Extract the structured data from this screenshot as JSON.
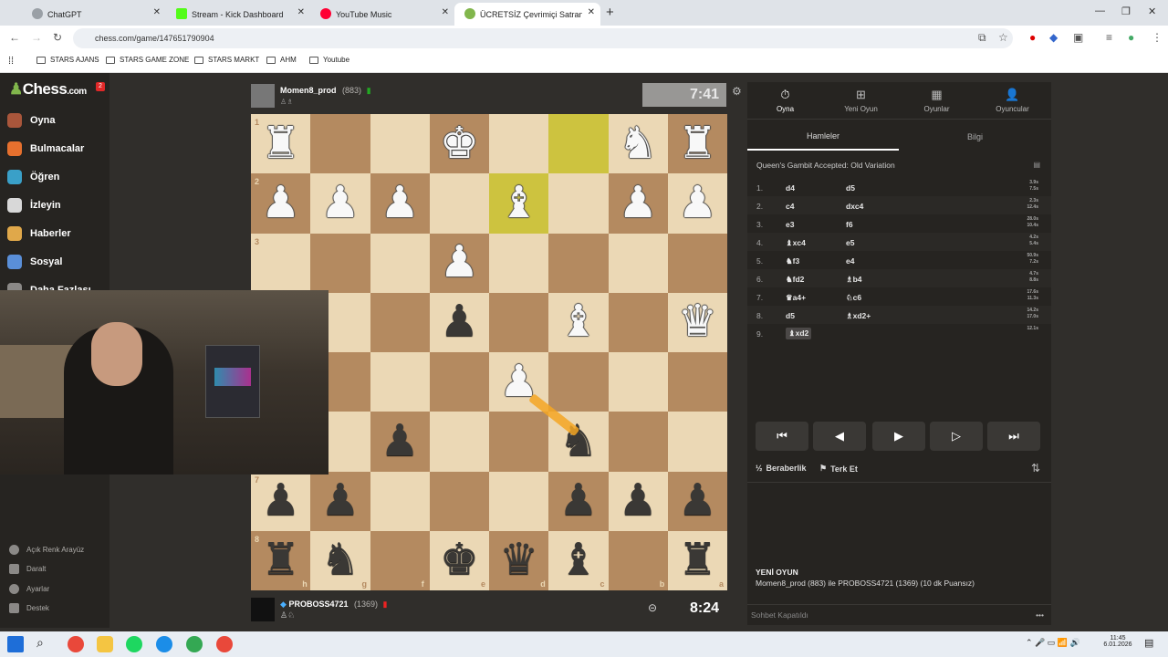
{
  "browser": {
    "tabs": [
      {
        "title": "ChatGPT",
        "color": "#9aa0a6"
      },
      {
        "title": "Stream - Kick Dashboard",
        "color": "#53fc18"
      },
      {
        "title": "YouTube Music",
        "color": "#ff0033"
      },
      {
        "title": "ÜCRETSİZ Çevrimiçi Satranç Oy",
        "color": "#81b64c"
      }
    ],
    "url": "chess.com/game/147651790904",
    "bookmarks": [
      "STARS AJANS",
      "STARS GAME ZONE",
      "STARS MARKT",
      "AHM",
      "Youtube"
    ]
  },
  "sidebar": {
    "logo": "Chess",
    "logo_suffix": ".com",
    "badge": "2",
    "nav": [
      "Oyna",
      "Bulmacalar",
      "Öğren",
      "İzleyin",
      "Haberler",
      "Sosyal",
      "Daha Fazlası"
    ],
    "footer": [
      "Açık Renk Arayüz",
      "Daralt",
      "Ayarlar",
      "Destek"
    ]
  },
  "top_player": {
    "name": "Momen8_prod",
    "rating": "(883)",
    "clock": "7:41"
  },
  "bottom_player": {
    "name": "PROBOSS4721",
    "rating": "(1369)",
    "clock": "8:24"
  },
  "board": {
    "ranks": [
      "1",
      "2",
      "3",
      "4",
      "5",
      "6",
      "7",
      "8"
    ],
    "files": [
      "h",
      "g",
      "f",
      "e",
      "d",
      "c",
      "b",
      "a"
    ],
    "light": "#ebd8b5",
    "dark": "#b48a60",
    "highlight": "#cdc33f"
  },
  "panel": {
    "tabs": [
      "Oyna",
      "Yeni Oyun",
      "Oyunlar",
      "Oyuncular"
    ],
    "subtabs": [
      "Hamleler",
      "Bilgi"
    ],
    "opening": "Queen's Gambit Accepted: Old Variation",
    "moves": [
      {
        "n": "1.",
        "w": "d4",
        "b": "d5",
        "tw": "3.9s",
        "tb": "7.5s"
      },
      {
        "n": "2.",
        "w": "c4",
        "b": "dxc4",
        "tw": "2.3s",
        "tb": "12.4s"
      },
      {
        "n": "3.",
        "w": "e3",
        "b": "f6",
        "tw": "28.0s",
        "tb": "10.4s"
      },
      {
        "n": "4.",
        "w": "♝xc4",
        "b": "e5",
        "tw": "4.2s",
        "tb": "5.4s"
      },
      {
        "n": "5.",
        "w": "♞f3",
        "b": "e4",
        "tw": "50.9s",
        "tb": "7.2s"
      },
      {
        "n": "6.",
        "w": "♞fd2",
        "b": "♗b4",
        "tw": "4.7s",
        "tb": "8.8s"
      },
      {
        "n": "7.",
        "w": "♛a4+",
        "b": "♘c6",
        "tw": "17.6s",
        "tb": "11.3s"
      },
      {
        "n": "8.",
        "w": "d5",
        "b": "♗xd2+",
        "tw": "14.2s",
        "tb": "17.0s"
      },
      {
        "n": "9.",
        "w": "♝xd2",
        "b": "",
        "tw": "12.1s",
        "tb": ""
      }
    ],
    "draw": "Beraberlik",
    "resign": "Terk Et",
    "new_game_title": "YENİ OYUN",
    "new_game_text": "Momen8_prod (883) ile PROBOSS4721 (1369) (10 dk Puansız)",
    "chat": "Sohbet Kapatıldı"
  },
  "taskbar": {
    "time": "11:45",
    "date": "6.01.2026"
  }
}
